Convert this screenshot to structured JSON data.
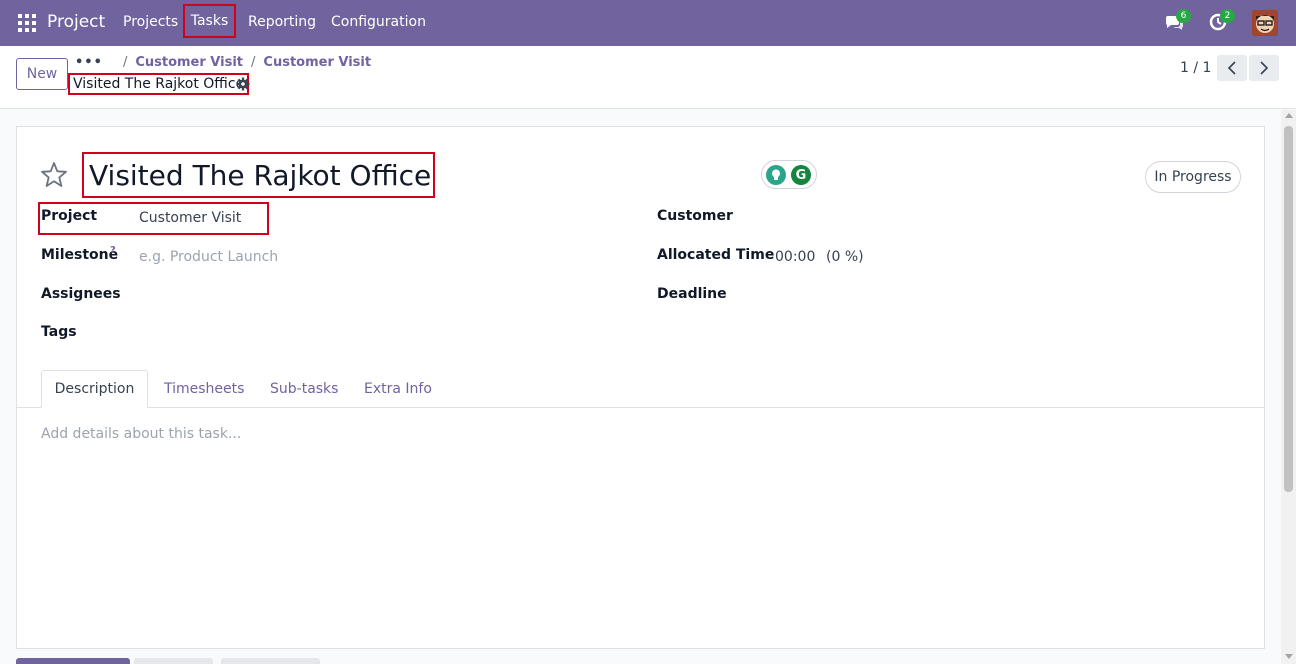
{
  "navbar": {
    "brand": "Project",
    "items": [
      "Projects",
      "Tasks",
      "Reporting",
      "Configuration"
    ],
    "messages_count": "6",
    "activities_count": "2"
  },
  "control": {
    "new_label": "New",
    "breadcrumb_dots": "•••",
    "breadcrumbs": [
      "Customer Visit",
      "Customer Visit"
    ],
    "current_record": "Visited The Rajkot Office",
    "pager": "1 / 1"
  },
  "form": {
    "title": "Visited The Rajkot Office",
    "status": "In Progress",
    "ai_icon_letter": "G",
    "fields_left": {
      "project_label": "Project",
      "project_value": "Customer Visit",
      "milestone_label": "Milestone",
      "milestone_help": "?",
      "milestone_placeholder": "e.g. Product Launch",
      "assignees_label": "Assignees",
      "tags_label": "Tags"
    },
    "fields_right": {
      "customer_label": "Customer",
      "allocated_label": "Allocated Time",
      "allocated_value": "00:00",
      "allocated_percent": "(0 %)",
      "deadline_label": "Deadline"
    },
    "tabs": [
      "Description",
      "Timesheets",
      "Sub-tasks",
      "Extra Info"
    ],
    "description_placeholder": "Add details about this task..."
  },
  "colors": {
    "navbar": "#71639e",
    "accent": "#71639e",
    "highlight_box": "#d0021b",
    "badge": "#28a745"
  }
}
